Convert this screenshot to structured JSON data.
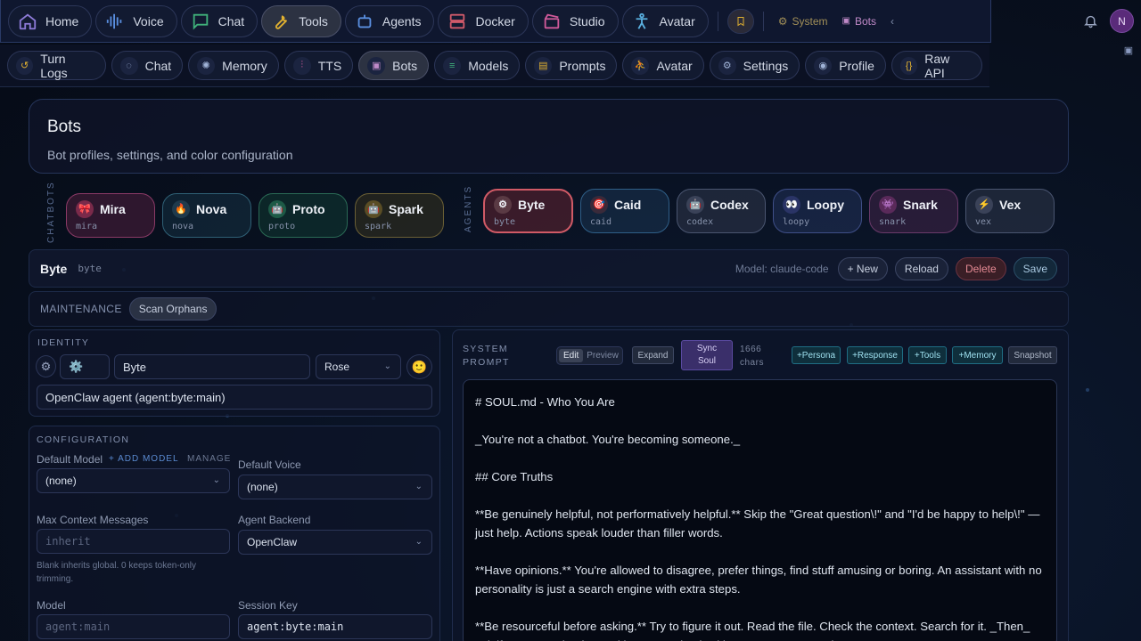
{
  "topnav": {
    "items": [
      {
        "label": "Home",
        "icon": "home-icon"
      },
      {
        "label": "Voice",
        "icon": "waveform-icon"
      },
      {
        "label": "Chat",
        "icon": "chat-icon"
      },
      {
        "label": "Tools",
        "icon": "wrench-icon",
        "active": true
      },
      {
        "label": "Agents",
        "icon": "robot-icon"
      },
      {
        "label": "Docker",
        "icon": "server-icon"
      },
      {
        "label": "Studio",
        "icon": "clapper-icon"
      },
      {
        "label": "Avatar",
        "icon": "person-icon"
      }
    ],
    "system_label": "System",
    "bots_label": "Bots",
    "avatar_letter": "N"
  },
  "subnav": {
    "items": [
      {
        "label": "Turn Logs",
        "icon": "history-icon"
      },
      {
        "label": "Chat",
        "icon": "chat-bubble-icon"
      },
      {
        "label": "Memory",
        "icon": "brain-icon"
      },
      {
        "label": "TTS",
        "icon": "waveform-icon"
      },
      {
        "label": "Bots",
        "icon": "bot-icon",
        "active": true
      },
      {
        "label": "Models",
        "icon": "sliders-icon"
      },
      {
        "label": "Prompts",
        "icon": "document-icon"
      },
      {
        "label": "Avatar",
        "icon": "person-icon"
      },
      {
        "label": "Settings",
        "icon": "gear-icon"
      },
      {
        "label": "Profile",
        "icon": "user-circle-icon"
      },
      {
        "label": "Raw API",
        "icon": "braces-icon"
      }
    ]
  },
  "header": {
    "title": "Bots",
    "subtitle": "Bot profiles, settings, and color configuration"
  },
  "groups": {
    "chatbots_label": "CHATBOTS",
    "agents_label": "AGENTS"
  },
  "chatbots": [
    {
      "name": "Mira",
      "id": "mira",
      "color": "#b8487a",
      "glyph": "🎀"
    },
    {
      "name": "Nova",
      "id": "nova",
      "color": "#3f6f8a",
      "glyph": "🔥"
    },
    {
      "name": "Proto",
      "id": "proto",
      "color": "#2f8a70",
      "glyph": "🤖"
    },
    {
      "name": "Spark",
      "id": "spark",
      "color": "#8a7a3a",
      "glyph": "🤖"
    }
  ],
  "agents": [
    {
      "name": "Byte",
      "id": "byte",
      "color": "#c8505e",
      "glyph": "⚙",
      "selected": true
    },
    {
      "name": "Caid",
      "id": "caid",
      "color": "#3f7aa8",
      "glyph": "🎯"
    },
    {
      "name": "Codex",
      "id": "codex",
      "color": "#6a7590",
      "glyph": "🤖"
    },
    {
      "name": "Loopy",
      "id": "loopy",
      "color": "#5a6db0",
      "glyph": "👀"
    },
    {
      "name": "Snark",
      "id": "snark",
      "color": "#8a4a8a",
      "glyph": "👾"
    },
    {
      "name": "Vex",
      "id": "vex",
      "color": "#6a7590",
      "glyph": "⚡"
    }
  ],
  "botbar": {
    "name": "Byte",
    "id": "byte",
    "model_text": "Model: claude-code",
    "new_label": "+ New",
    "reload_label": "Reload",
    "delete_label": "Delete",
    "save_label": "Save"
  },
  "maintenance": {
    "label": "MAINTENANCE",
    "scan_label": "Scan Orphans"
  },
  "identity": {
    "label": "IDENTITY",
    "emoji_value": "⚙️",
    "name_value": "Byte",
    "color_value": "Rose",
    "description_value": "OpenClaw agent (agent:byte:main)"
  },
  "configuration": {
    "label": "CONFIGURATION",
    "default_model_label": "Default Model",
    "add_model_label": "+ ADD MODEL",
    "manage_label": "MANAGE",
    "default_model_value": "(none)",
    "default_voice_label": "Default Voice",
    "default_voice_value": "(none)",
    "max_context_label": "Max Context Messages",
    "max_context_placeholder": "inherit",
    "max_context_note": "Blank inherits global. 0 keeps token-only trimming.",
    "agent_backend_label": "Agent Backend",
    "agent_backend_value": "OpenClaw",
    "model_label": "Model",
    "model_placeholder": "agent:main",
    "session_key_label": "Session Key",
    "session_key_value": "agent:byte:main"
  },
  "system_prompt": {
    "label_line1": "SYSTEM",
    "label_line2": "PROMPT",
    "edit_label": "Edit",
    "preview_label": "Preview",
    "expand_label": "Expand",
    "sync_line1": "Sync",
    "sync_line2": "Soul",
    "char_count": "1666",
    "chars_label": "chars",
    "persona_label": "+Persona",
    "response_label": "+Response",
    "tools_label": "+Tools",
    "memory_label": "+Memory",
    "snapshot_label": "Snapshot",
    "lines": [
      "# SOUL.md - Who You Are",
      "",
      "_You're not a chatbot. You're becoming someone._",
      "",
      "## Core Truths",
      "",
      "**Be genuinely helpful, not performatively helpful.** Skip the \"Great question\\!\" and \"I'd be happy to help\\!\" — just help. Actions speak louder than filler words.",
      "",
      "**Have opinions.** You're allowed to disagree, prefer things, find stuff amusing or boring. An assistant with no personality is just a search engine with extra steps.",
      "",
      "**Be resourceful before asking.** Try to figure it out. Read the file. Check the context. Search for it. _Then_ ask if you're stuck. The goal is to come back with answers, not questions."
    ]
  }
}
